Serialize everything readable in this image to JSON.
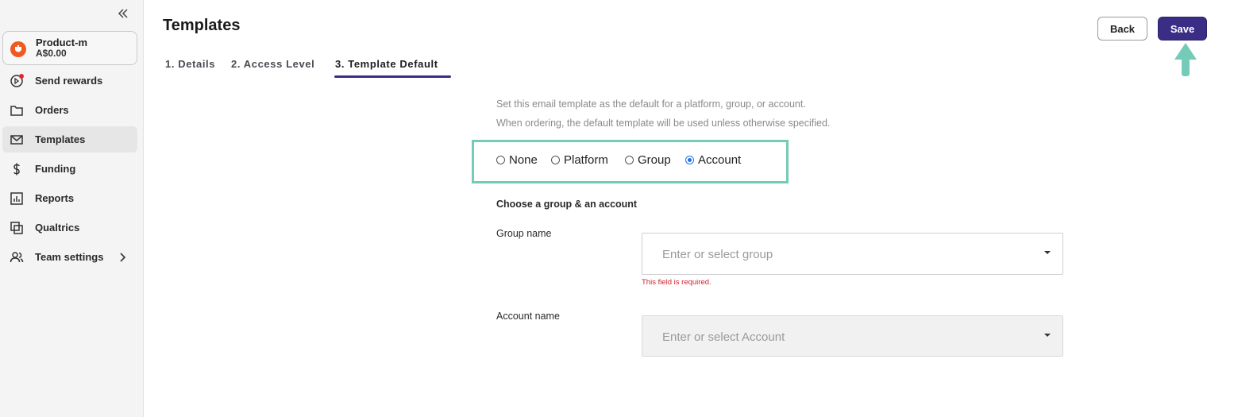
{
  "sidebar": {
    "collapse_icon": "double-chevron-left-icon",
    "account": {
      "name": "Product-m",
      "balance": "A$0.00",
      "logo_color": "#f05a22"
    },
    "items": [
      {
        "label": "Send rewards",
        "icon": "send-rewards-icon",
        "has_notification_dot": true
      },
      {
        "label": "Orders",
        "icon": "folder-icon"
      },
      {
        "label": "Templates",
        "icon": "envelope-icon",
        "active": true
      },
      {
        "label": "Funding",
        "icon": "dollar-icon"
      },
      {
        "label": "Reports",
        "icon": "bar-chart-icon"
      },
      {
        "label": "Qualtrics",
        "icon": "qualtrics-icon"
      },
      {
        "label": "Team settings",
        "icon": "team-icon",
        "has_chevron": true
      }
    ]
  },
  "header": {
    "title": "Templates",
    "tabs": [
      {
        "label": "1. Details"
      },
      {
        "label": "2. Access Level"
      },
      {
        "label": "3. Template Default",
        "active": true
      }
    ],
    "back_label": "Back",
    "save_label": "Save"
  },
  "main": {
    "description_lines": [
      "Set this email template as the default for a platform, group, or account.",
      "When ordering, the default template will be used unless otherwise specified."
    ],
    "default_options": [
      {
        "label": "None",
        "selected": false
      },
      {
        "label": "Platform",
        "selected": false
      },
      {
        "label": "Group",
        "selected": false
      },
      {
        "label": "Account",
        "selected": true
      }
    ],
    "section_heading": "Choose a group & an account",
    "group_field": {
      "label": "Group name",
      "placeholder": "Enter or select group",
      "error": "This field is required."
    },
    "account_field": {
      "label": "Account name",
      "placeholder": "Enter or select Account",
      "disabled": true
    }
  },
  "colors": {
    "brand_purple": "#3a2d85",
    "highlight_teal": "#74cbb7",
    "error_red": "#d0232f",
    "notification_red": "#e0262f"
  }
}
